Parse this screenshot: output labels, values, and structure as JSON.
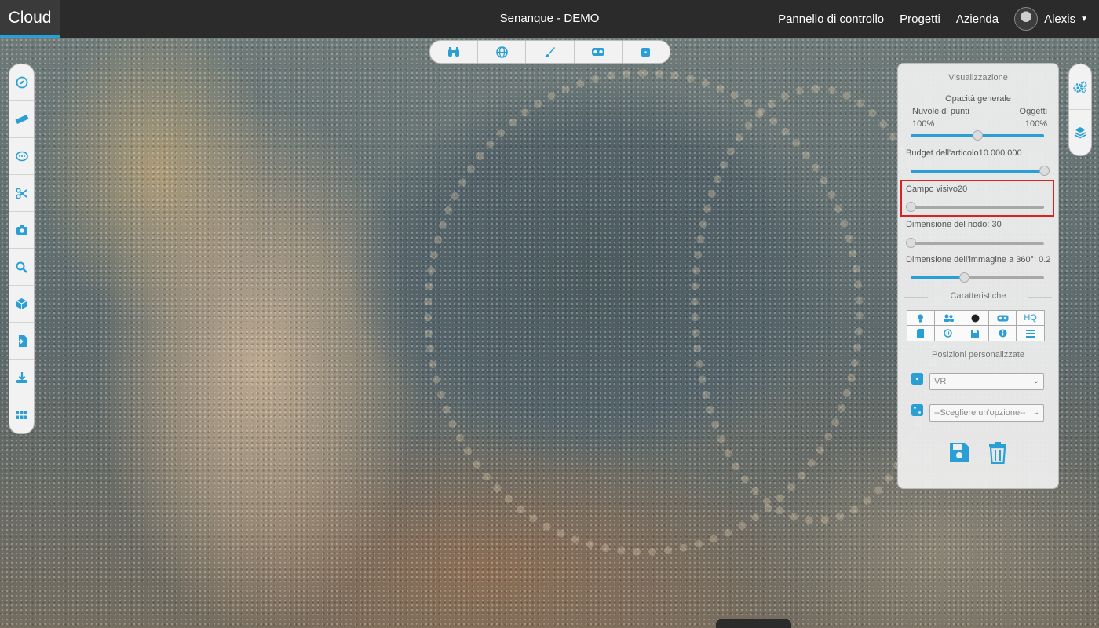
{
  "header": {
    "brand": "Cloud",
    "project_title": "Senanque - DEMO",
    "nav": [
      "Pannello di controllo",
      "Progetti",
      "Azienda"
    ],
    "user_name": "Alexis"
  },
  "toolstrip": [
    "binoculars-icon",
    "globe-icon",
    "brush-icon",
    "vr-glasses-icon",
    "cube-icon"
  ],
  "left_toolbar": [
    "compass-icon",
    "ruler-icon",
    "comment-icon",
    "scissors-icon",
    "camera-icon",
    "search-icon",
    "box-icon",
    "file-import-icon",
    "download-icon",
    "grid-icon"
  ],
  "right_toolbar": [
    "settings-gears-icon",
    "layers-icon"
  ],
  "panel": {
    "visualization_title": "Visualizzazione",
    "opacity_label": "Opacità generale",
    "point_clouds_label": "Nuvole di punti",
    "objects_label": "Oggetti",
    "point_clouds_pct": "100%",
    "objects_pct": "100%",
    "opacity_balance": 0.5,
    "budget_label": "Budget dell'articolo10.000.000",
    "budget_value": 1.0,
    "fov_label": "Campo visivo20",
    "fov_value": 0.0,
    "node_size_label": "Dimensione del nodo: 30",
    "node_size_value": 0.0,
    "image360_label": "Dimensione dell'immagine a 360°: 0.2",
    "image360_value": 0.4,
    "features_title": "Caratteristiche",
    "features_hq": "HQ",
    "positions_title": "Posizioni personalizzate",
    "position_select_1": "VR",
    "position_select_2": "--Scegliere un'opzione--"
  },
  "colors": {
    "accent": "#2a9fd6",
    "topbar": "#2b2b2b",
    "highlight": "#e02020"
  }
}
